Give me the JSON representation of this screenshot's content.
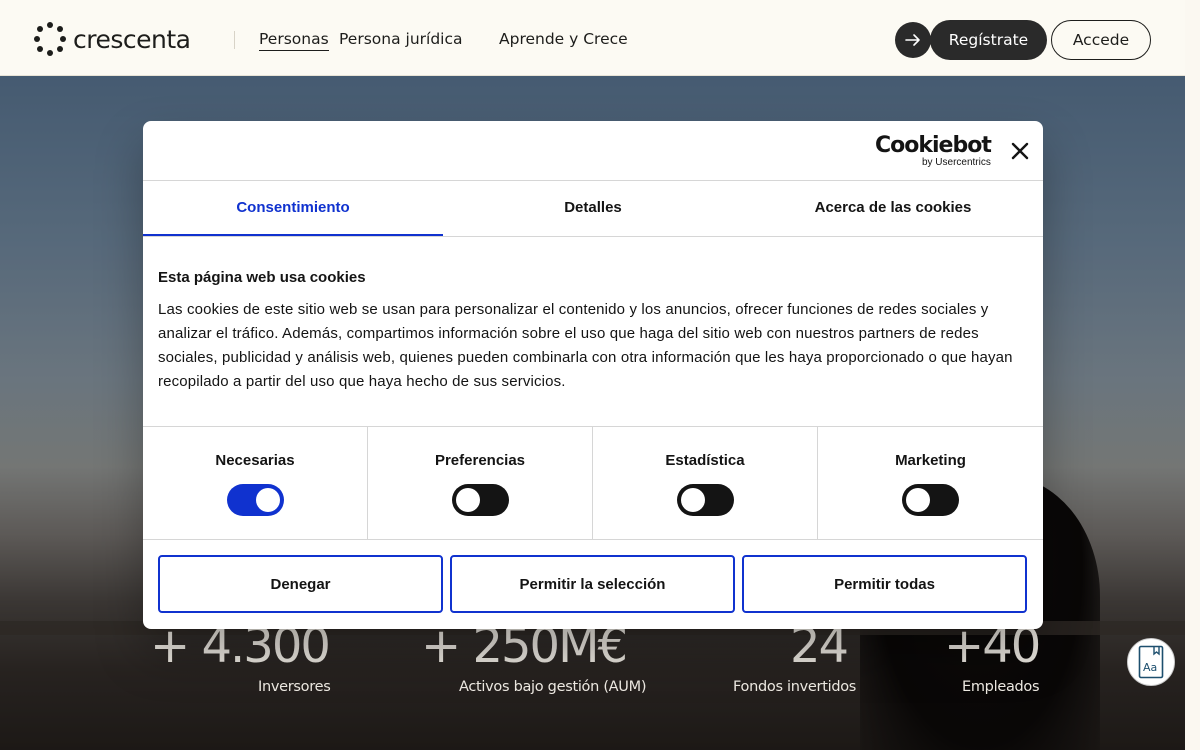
{
  "header": {
    "logo_text": "crescenta",
    "nav": [
      {
        "label": "Personas",
        "active": true
      },
      {
        "label": "Persona jurídica",
        "active": false
      },
      {
        "label": "Aprende y Crece",
        "active": false
      }
    ],
    "register_label": "Regístrate",
    "login_label": "Accede"
  },
  "hero": {
    "stats": [
      {
        "value": "+ 4.300",
        "label": "Inversores"
      },
      {
        "value": "+ 250M€",
        "label": "Activos bajo gestión (AUM)"
      },
      {
        "value": "24",
        "label": "Fondos invertidos"
      },
      {
        "value": "+40",
        "label": "Empleados"
      }
    ]
  },
  "cookie_dialog": {
    "brand": "Cookiebot",
    "brand_sub": "by Usercentrics",
    "tabs": [
      {
        "label": "Consentimiento",
        "active": true
      },
      {
        "label": "Detalles",
        "active": false
      },
      {
        "label": "Acerca de las cookies",
        "active": false
      }
    ],
    "title": "Esta página web usa cookies",
    "body": "Las cookies de este sitio web se usan para personalizar el contenido y los anuncios, ofrecer funciones de redes sociales y analizar el tráfico. Además, compartimos información sobre el uso que haga del sitio web con nuestros partners de redes sociales, publicidad y análisis web, quienes pueden combinarla con otra información que les haya proporcionado o que hayan recopilado a partir del uso que haya hecho de sus servicios.",
    "toggles": [
      {
        "label": "Necesarias",
        "on": true
      },
      {
        "label": "Preferencias",
        "on": false
      },
      {
        "label": "Estadística",
        "on": false
      },
      {
        "label": "Marketing",
        "on": false
      }
    ],
    "buttons": {
      "deny": "Denegar",
      "allow_selection": "Permitir la selección",
      "allow_all": "Permitir todas"
    }
  },
  "colors": {
    "accent": "#1032cf",
    "dark": "#1d1d1b",
    "header_bg": "#fcfaf3"
  }
}
